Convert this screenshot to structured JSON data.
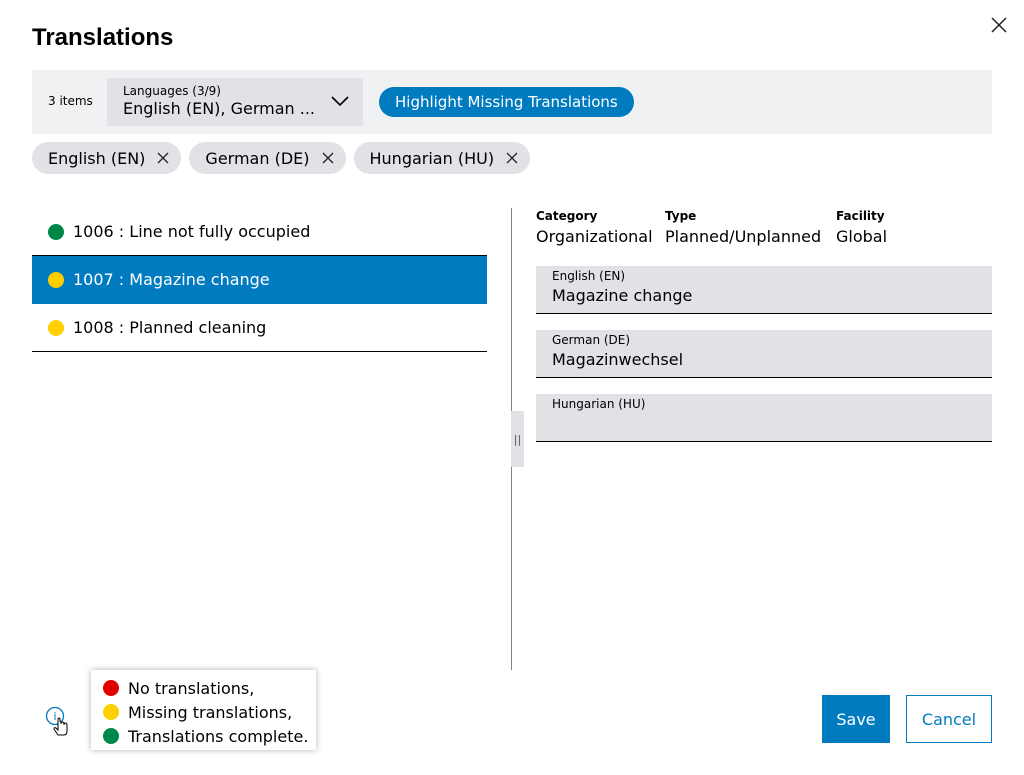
{
  "dialog": {
    "title": "Translations",
    "close_icon": "close-icon"
  },
  "toolbar": {
    "item_count": "3 items",
    "language_select": {
      "label": "Languages (3/9)",
      "value": "English (EN), German ..."
    },
    "highlight_button": "Highlight Missing Translations"
  },
  "chips": [
    {
      "label": "English (EN)"
    },
    {
      "label": "German (DE)"
    },
    {
      "label": "Hungarian (HU)"
    }
  ],
  "list": [
    {
      "label": "1006 : Line not fully occupied",
      "status_color": "#00884a",
      "selected": false
    },
    {
      "label": "1007 : Magazine change",
      "status_color": "#ffcf00",
      "selected": true
    },
    {
      "label": "1008 : Planned cleaning",
      "status_color": "#ffcf00",
      "selected": false
    }
  ],
  "details": {
    "category": {
      "label": "Category",
      "value": "Organizational"
    },
    "type": {
      "label": "Type",
      "value": "Planned/Unplanned"
    },
    "facility": {
      "label": "Facility",
      "value": "Global"
    },
    "fields": [
      {
        "label": "English (EN)",
        "value": "Magazine change"
      },
      {
        "label": "German (DE)",
        "value": "Magazinwechsel"
      },
      {
        "label": "Hungarian (HU)",
        "value": ""
      }
    ]
  },
  "legend": [
    {
      "label": "No translations,",
      "color": "#e00000"
    },
    {
      "label": "Missing translations,",
      "color": "#ffcf00"
    },
    {
      "label": "Translations complete.",
      "color": "#00884a"
    }
  ],
  "footer": {
    "save_label": "Save",
    "cancel_label": "Cancel"
  },
  "colors": {
    "accent": "#007bc0"
  }
}
